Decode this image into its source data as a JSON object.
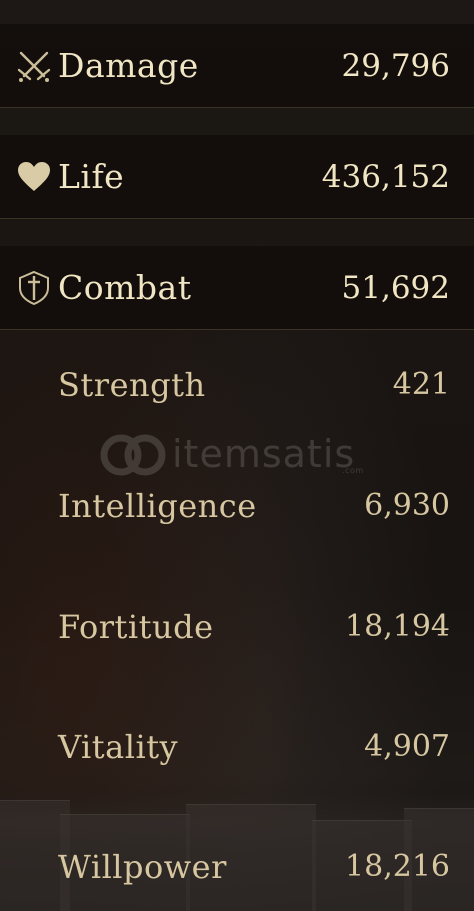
{
  "headline_stats": [
    {
      "icon": "crossed-swords-icon",
      "label": "Damage",
      "value": "29,796"
    },
    {
      "icon": "heart-icon",
      "label": "Life",
      "value": "436,152"
    },
    {
      "icon": "shield-sword-icon",
      "label": "Combat",
      "value": "51,692"
    }
  ],
  "attributes": [
    {
      "label": "Strength",
      "value": "421"
    },
    {
      "label": "Intelligence",
      "value": "6,930"
    },
    {
      "label": "Fortitude",
      "value": "18,194"
    },
    {
      "label": "Vitality",
      "value": "4,907"
    },
    {
      "label": "Willpower",
      "value": "18,216"
    }
  ],
  "watermark": {
    "text": "itemsatis",
    "domain": ".com"
  },
  "colors": {
    "headline_text": "#f1e6c4",
    "attribute_text": "#d7c7a1",
    "divider": "#3b3225",
    "background": "#1a1512"
  }
}
